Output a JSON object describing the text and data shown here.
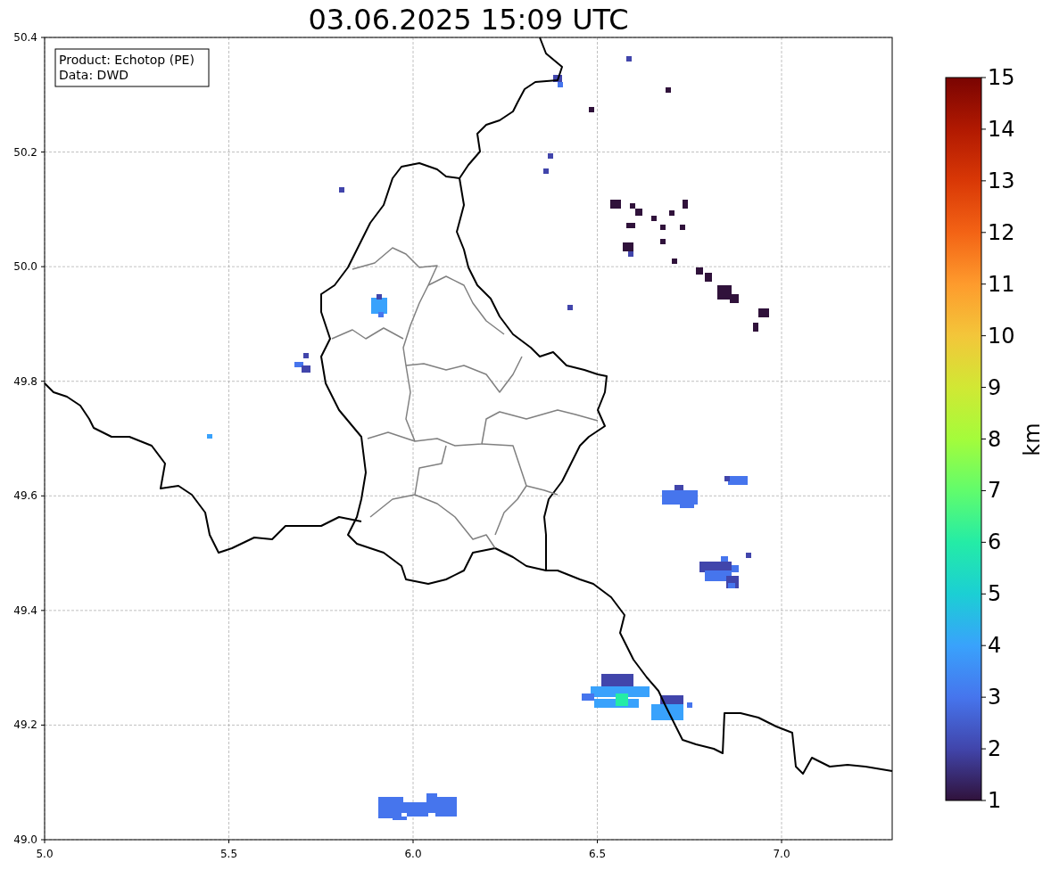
{
  "title": "03.06.2025 15:09 UTC",
  "info_box": [
    "Product: Echotop (PE)",
    "Data: DWD"
  ],
  "x_axis": {
    "ticks": [
      "5.0",
      "5.5",
      "6.0",
      "6.5",
      "7.0"
    ]
  },
  "y_axis": {
    "ticks": [
      "50.4",
      "50.2",
      "50.0",
      "49.8",
      "49.6",
      "49.4",
      "49.2",
      "49.0"
    ]
  },
  "colorbar": {
    "label": "km",
    "ticks": [
      "15",
      "14",
      "13",
      "12",
      "11",
      "10",
      "9",
      "8",
      "7",
      "6",
      "5",
      "4",
      "3",
      "2",
      "1"
    ]
  }
}
